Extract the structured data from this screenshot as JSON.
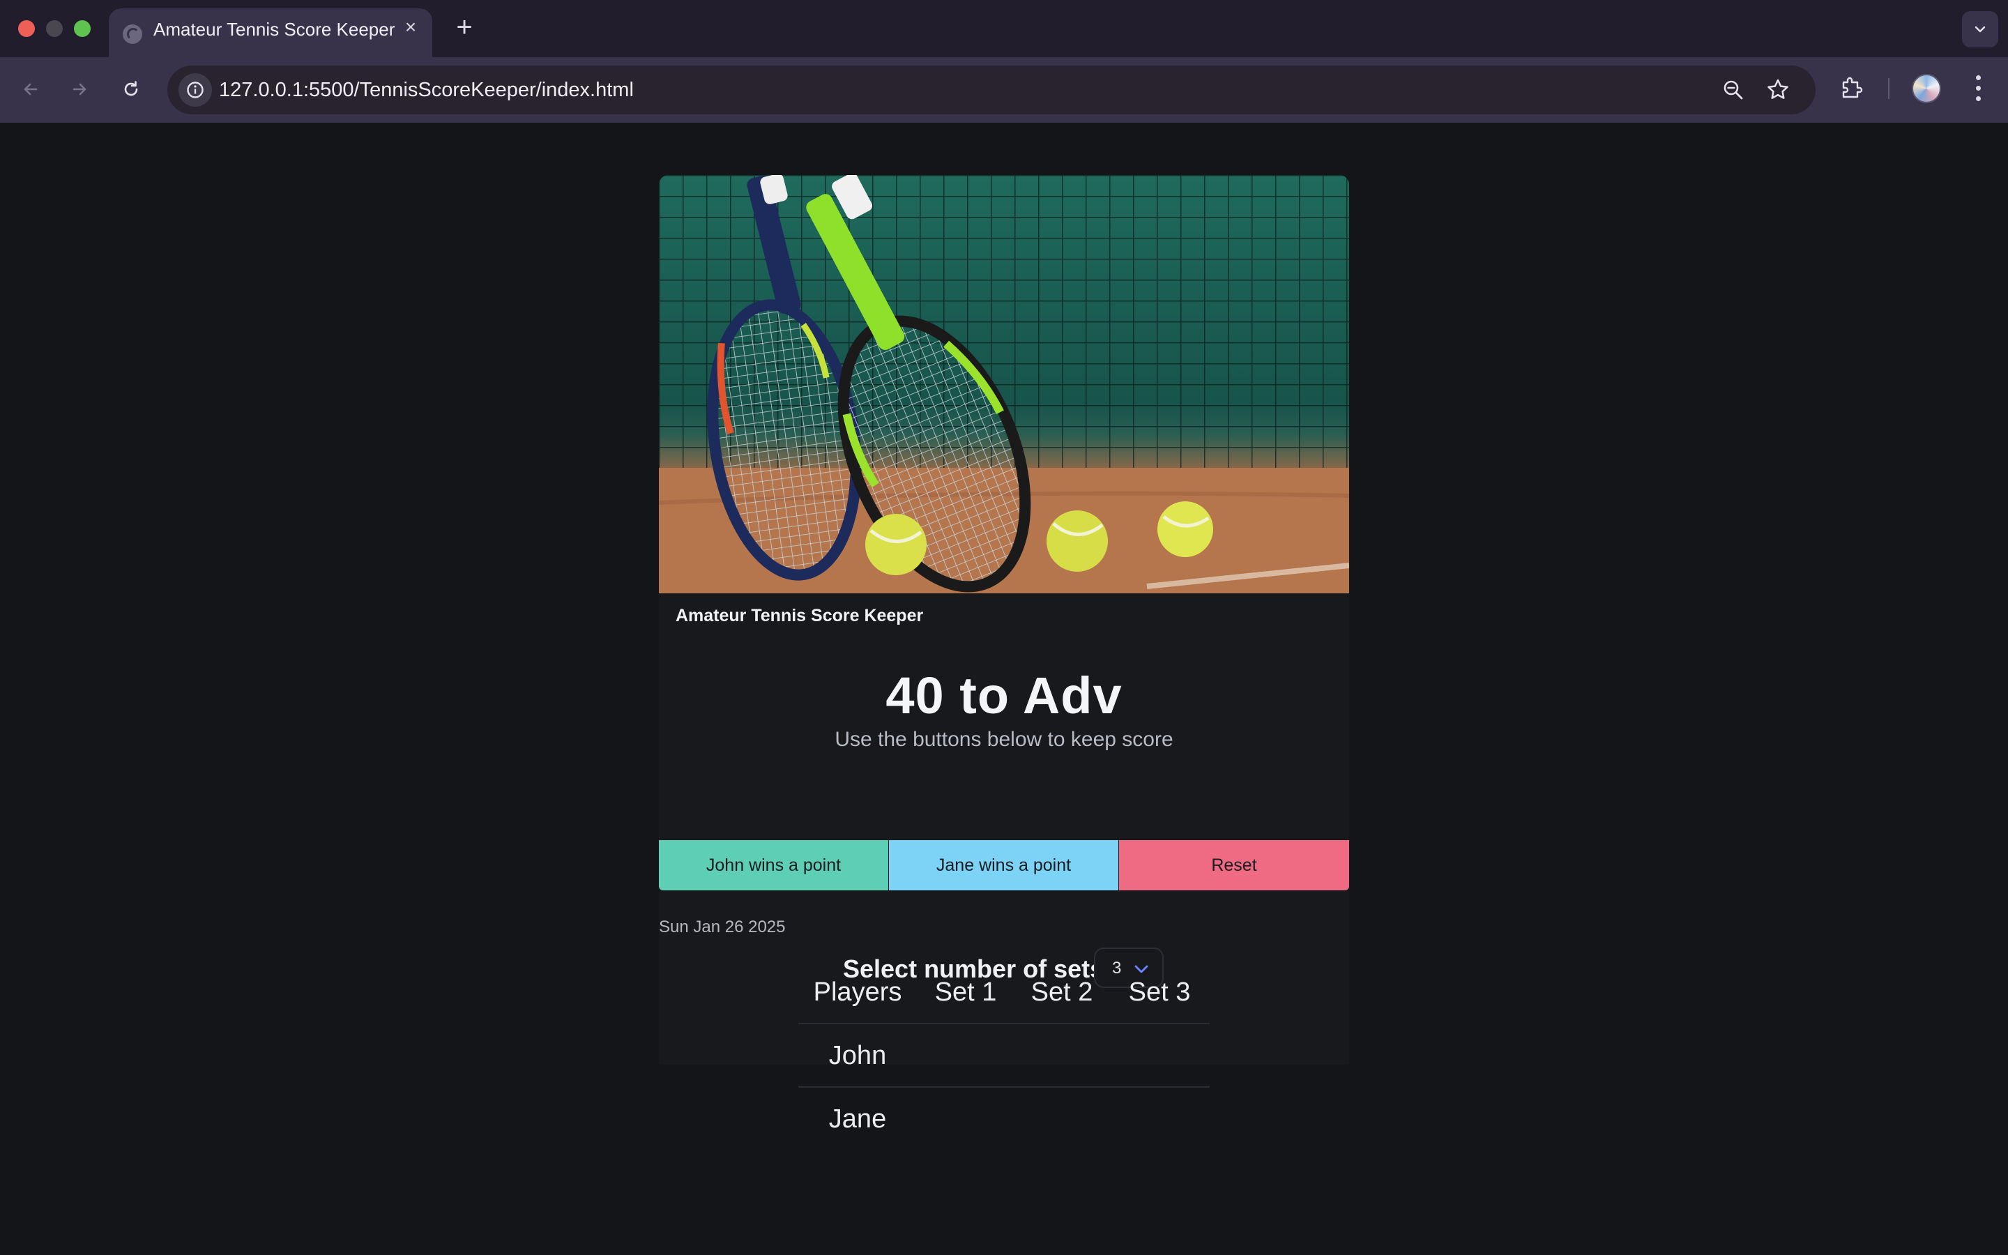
{
  "browser": {
    "tab_title": "Amateur Tennis Score Keeper",
    "url": "127.0.0.1:5500/TennisScoreKeeper/index.html"
  },
  "app": {
    "card_title": "Amateur Tennis Score Keeper",
    "score_text": "40 to Adv",
    "hint": "Use the buttons below to keep score",
    "sets_label": "Select number of sets",
    "sets_value": "3",
    "buttons": {
      "john": "John wins a point",
      "jane": "Jane wins a point",
      "reset": "Reset"
    },
    "date": "Sun Jan 26 2025",
    "table": {
      "headers": [
        "Players",
        "Set 1",
        "Set 2",
        "Set 3"
      ],
      "rows": [
        [
          "John",
          "",
          "",
          ""
        ],
        [
          "Jane",
          "",
          "",
          ""
        ]
      ]
    }
  },
  "colors": {
    "page_bg": "#141519",
    "john_button": "#5ecfb4",
    "jane_button": "#7dd3f6",
    "reset_button": "#ef6b83"
  }
}
